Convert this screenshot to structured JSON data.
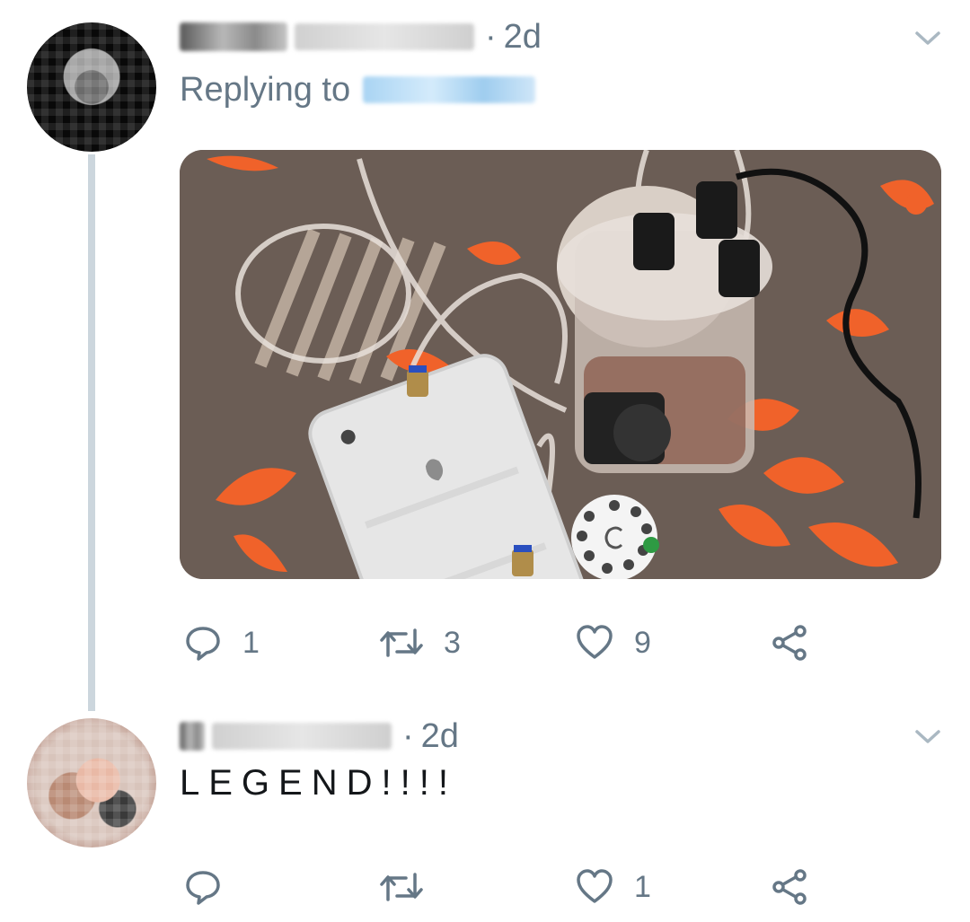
{
  "tweets": [
    {
      "time_sep": "·",
      "time": "2d",
      "replying_label": "Replying to",
      "actions": {
        "reply_count": "1",
        "retweet_count": "3",
        "like_count": "9"
      },
      "icons": {
        "reply": "reply-icon",
        "retweet": "retweet-icon",
        "like": "heart-icon",
        "share": "share-icon",
        "menu": "chevron-down-icon"
      }
    },
    {
      "time_sep": "·",
      "time": "2d",
      "text": "LEGEND!!!!",
      "actions": {
        "reply_count": "",
        "retweet_count": "",
        "like_count": "1"
      },
      "icons": {
        "reply": "reply-icon",
        "retweet": "retweet-icon",
        "like": "heart-icon",
        "share": "share-icon",
        "menu": "chevron-down-icon"
      }
    }
  ],
  "colors": {
    "secondary_text": "#657786",
    "primary_text": "#14171a",
    "thread_line": "#ccd6dd",
    "media_bg": "#6b5d55",
    "accent_orange": "#f0622a"
  }
}
